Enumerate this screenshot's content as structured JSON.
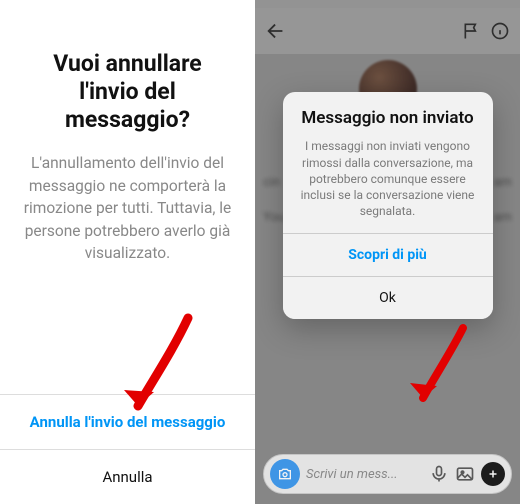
{
  "left": {
    "title": "Vuoi annullare l'invio del messaggio?",
    "body": "L'annullamento dell'invio del messaggio ne comporterà la rimozione per tutti. Tuttavia, le persone potrebbero averlo già visualizzato.",
    "unsend": "Annulla l'invio del messaggio",
    "cancel": "Annulla"
  },
  "right": {
    "blur_left1": "cin",
    "blur_right1": "am",
    "blur_left2": "You",
    "blur_right2": "am",
    "modal": {
      "title": "Messaggio non inviato",
      "body": "I messaggi non inviati vengono rimossi dalla conversazione, ma potrebbero comunque essere inclusi se la conversazione viene segnalata.",
      "learn": "Scopri di più",
      "ok": "Ok"
    },
    "composer_placeholder": "Scrivi un mess..."
  }
}
